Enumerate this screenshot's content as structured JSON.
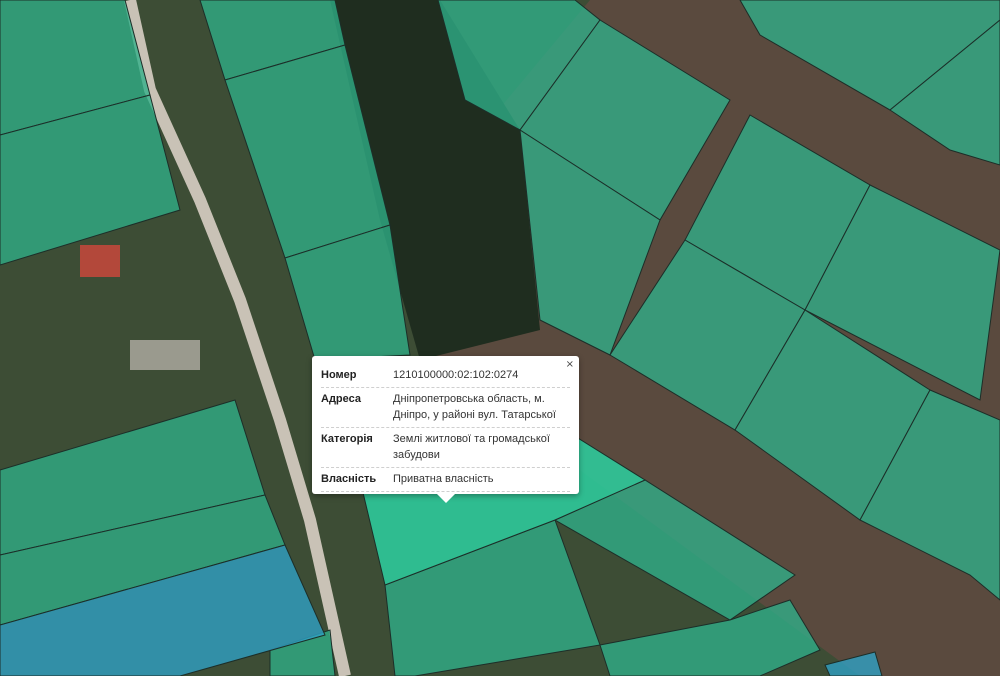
{
  "map": {
    "colors": {
      "parcel_green": "#2fb08a",
      "parcel_blue": "#2f9fc0",
      "parcel_selected": "#2ec99a",
      "road": "#c9c2b6",
      "bare_ground": "#5b4b40"
    }
  },
  "popup": {
    "close_label": "×",
    "fields": [
      {
        "key": "Номер",
        "value": "1210100000:02:102:0274"
      },
      {
        "key": "Адреса",
        "value": "Дніпропетровська область, м. Дніпро, у районі вул. Татарської"
      },
      {
        "key": "Категорія",
        "value": "Землі житлової та громадської забудови"
      },
      {
        "key": "Власність",
        "value": "Приватна власність"
      }
    ]
  }
}
